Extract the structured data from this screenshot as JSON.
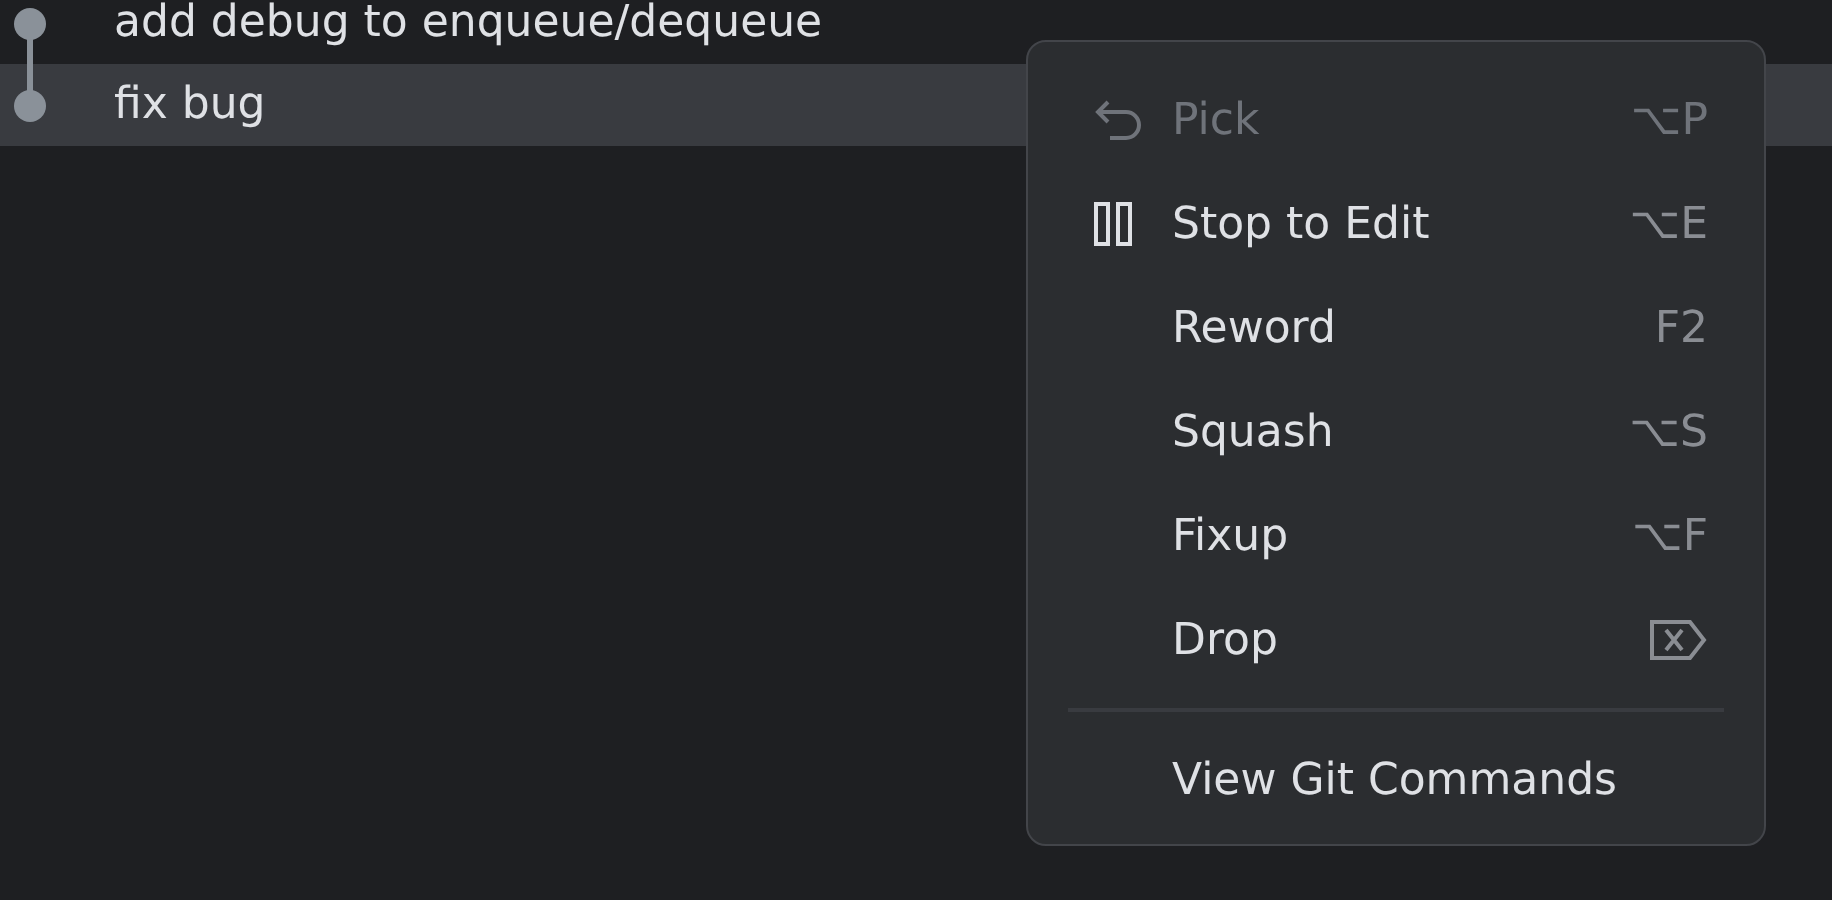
{
  "commits": [
    {
      "message": "add debug to enqueue/dequeue",
      "selected": false
    },
    {
      "message": "fix bug",
      "selected": true
    }
  ],
  "context_menu": {
    "items": [
      {
        "kind": "undo",
        "label": "Pick",
        "shortcut": "⌥P",
        "disabled": true
      },
      {
        "kind": "pause",
        "label": "Stop to Edit",
        "shortcut": "⌥E",
        "disabled": false
      },
      {
        "kind": "plain",
        "label": "Reword",
        "shortcut": "F2",
        "disabled": false
      },
      {
        "kind": "plain",
        "label": "Squash",
        "shortcut": "⌥S",
        "disabled": false
      },
      {
        "kind": "plain",
        "label": "Fixup",
        "shortcut": "⌥F",
        "disabled": false
      },
      {
        "kind": "delete",
        "label": "Drop",
        "disabled": false
      }
    ],
    "footer_items": [
      {
        "label": "View Git Commands",
        "disabled": false
      }
    ]
  }
}
